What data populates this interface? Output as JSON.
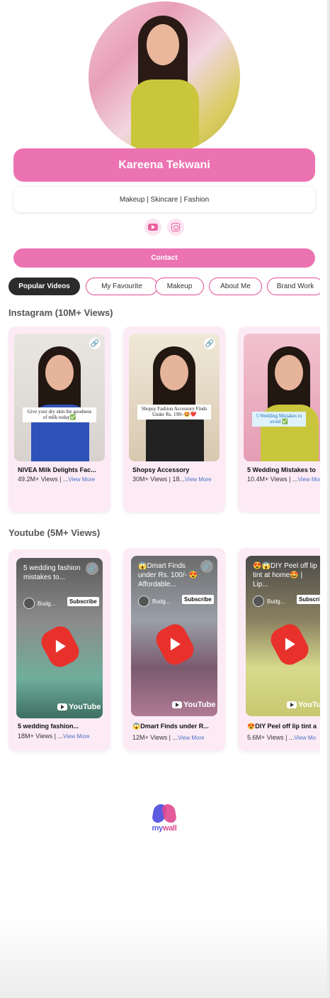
{
  "profile": {
    "name": "Kareena Tekwani",
    "tagline": "Makeup | Skincare | Fashion",
    "contact_label": "Contact",
    "social": [
      "youtube-icon",
      "instagram-icon"
    ]
  },
  "tabs": [
    "Popular Videos",
    "My Favourite",
    "Makeup",
    "About Me",
    "Brand Work"
  ],
  "instagram": {
    "title": "Instagram (10M+ Views)",
    "cards": [
      {
        "caption": "Give your dry skin the goodness of milk today✅",
        "title": "NIVEA Milk Delights Fac...",
        "views": "49.2M+ Views | ...",
        "more": "View More"
      },
      {
        "caption": "Shopsy Fashion Accessory Finds Under Rs. 199/-🤩❤️",
        "title": "Shopsy Accessory",
        "views": "30M+ Views | 18...",
        "more": "View More"
      },
      {
        "caption": "5 Wedding Mistakes to avoid ✅",
        "title": "5 Wedding Mistakes to",
        "views": "10.4M+ Views | ...",
        "more": "View More"
      }
    ]
  },
  "youtube": {
    "title": "Youtube (5M+ Views)",
    "cards": [
      {
        "headline": "5 wedding fashion mistakes to...",
        "channel": "Budg...",
        "subscribe": "Subscribe",
        "logo": "YouTube",
        "title": "5 wedding fashion...",
        "views": "18M+ Views | ...",
        "more": "View More"
      },
      {
        "headline": "😱Dmart Finds under Rs. 100/- 😍 Affordable...",
        "channel": "Budg...",
        "subscribe": "Subscribe",
        "logo": "YouTube",
        "title": "😱Dmart Finds under R...",
        "views": "12M+ Views | ...",
        "more": "View More"
      },
      {
        "headline": "😍😱DIY Peel off lip tint at home🤩 | Lip...",
        "channel": "Budg...",
        "subscribe": "Subscri",
        "logo": "YouTu",
        "title": "😍DIY Peel off lip tint a",
        "views": "5.6M+ Views | ...",
        "more": "View Mo"
      }
    ]
  },
  "footer": {
    "brand_a": "my",
    "brand_b": "wall"
  },
  "colors": {
    "accent": "#ec73b2",
    "active_tab": "#2b2b2b",
    "card_bg": "#fcebf5"
  }
}
